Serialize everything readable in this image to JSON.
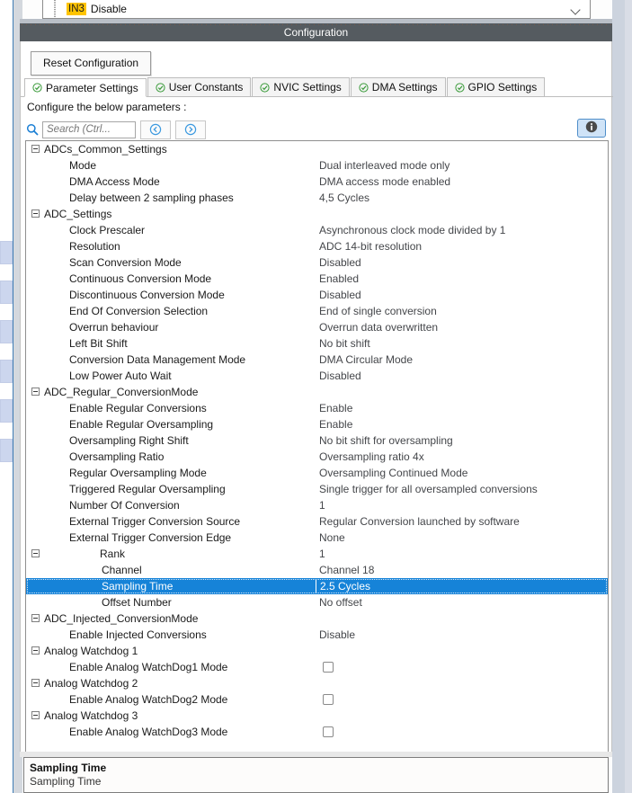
{
  "top_row": {
    "pin_tag": "IN3",
    "value": "Disable",
    "caret_icon": "chevron-down-icon"
  },
  "config_bar": {
    "title": "Configuration"
  },
  "toolbar": {
    "reset_label": "Reset Configuration"
  },
  "tabs": [
    {
      "label": "Parameter Settings",
      "icon": "check-circle-icon",
      "active": true
    },
    {
      "label": "User Constants",
      "icon": "check-circle-icon",
      "active": false
    },
    {
      "label": "NVIC Settings",
      "icon": "check-circle-icon",
      "active": false
    },
    {
      "label": "DMA Settings",
      "icon": "check-circle-icon",
      "active": false
    },
    {
      "label": "GPIO Settings",
      "icon": "check-circle-icon",
      "active": false
    }
  ],
  "configure_label": "Configure the below parameters :",
  "search": {
    "icon": "search-icon",
    "placeholder": "Search (Ctrl...",
    "value": "",
    "prev_icon": "chevron-left-circle-icon",
    "next_icon": "chevron-right-circle-icon"
  },
  "info_button": {
    "icon": "info-icon",
    "label": ""
  },
  "colors": {
    "selection": "#1683d8",
    "title_bar": "#555b60",
    "highlight_tag": "#ffc400",
    "check_green": "#3a9b3a",
    "accent_blue": "#4f8ec9"
  },
  "tree": [
    {
      "level": 0,
      "expander": true,
      "label": "ADCs_Common_Settings",
      "value": ""
    },
    {
      "level": 1,
      "expander": false,
      "label": "Mode",
      "value": "Dual interleaved mode only"
    },
    {
      "level": 1,
      "expander": false,
      "label": "DMA Access Mode",
      "value": "DMA access mode enabled"
    },
    {
      "level": 1,
      "expander": false,
      "label": "Delay between 2 sampling phases",
      "value": "4,5 Cycles"
    },
    {
      "level": 0,
      "expander": true,
      "label": "ADC_Settings",
      "value": ""
    },
    {
      "level": 1,
      "expander": false,
      "label": "Clock Prescaler",
      "value": "Asynchronous clock mode divided by 1"
    },
    {
      "level": 1,
      "expander": false,
      "label": "Resolution",
      "value": "ADC 14-bit resolution"
    },
    {
      "level": 1,
      "expander": false,
      "label": "Scan Conversion Mode",
      "value": "Disabled"
    },
    {
      "level": 1,
      "expander": false,
      "label": "Continuous Conversion Mode",
      "value": "Enabled"
    },
    {
      "level": 1,
      "expander": false,
      "label": "Discontinuous Conversion Mode",
      "value": "Disabled"
    },
    {
      "level": 1,
      "expander": false,
      "label": "End Of Conversion Selection",
      "value": "End of single conversion"
    },
    {
      "level": 1,
      "expander": false,
      "label": "Overrun behaviour",
      "value": "Overrun data overwritten"
    },
    {
      "level": 1,
      "expander": false,
      "label": "Left Bit Shift",
      "value": "No bit shift"
    },
    {
      "level": 1,
      "expander": false,
      "label": "Conversion Data Management Mode",
      "value": "DMA Circular Mode"
    },
    {
      "level": 1,
      "expander": false,
      "label": "Low Power Auto Wait",
      "value": "Disabled"
    },
    {
      "level": 0,
      "expander": true,
      "label": "ADC_Regular_ConversionMode",
      "value": ""
    },
    {
      "level": 1,
      "expander": false,
      "label": "Enable Regular Conversions",
      "value": "Enable"
    },
    {
      "level": 1,
      "expander": false,
      "label": "Enable Regular Oversampling",
      "value": "Enable"
    },
    {
      "level": 1,
      "expander": false,
      "label": "Oversampling Right Shift",
      "value": "No bit shift for oversampling"
    },
    {
      "level": 1,
      "expander": false,
      "label": "Oversampling Ratio",
      "value": "Oversampling ratio 4x"
    },
    {
      "level": 1,
      "expander": false,
      "label": "Regular Oversampling Mode",
      "value": "Oversampling Continued Mode"
    },
    {
      "level": 1,
      "expander": false,
      "label": "Triggered Regular Oversampling",
      "value": "Single trigger for all oversampled conversions"
    },
    {
      "level": 1,
      "expander": false,
      "label": "Number Of Conversion",
      "value": "1"
    },
    {
      "level": 1,
      "expander": false,
      "label": "External Trigger Conversion Source",
      "value": "Regular Conversion launched by software"
    },
    {
      "level": 1,
      "expander": false,
      "label": "External Trigger Conversion Edge",
      "value": "None"
    },
    {
      "level": "1b",
      "expander": true,
      "label": "Rank",
      "value": "1"
    },
    {
      "level": 2,
      "expander": false,
      "label": "Channel",
      "value": "Channel 18"
    },
    {
      "level": 2,
      "expander": false,
      "label": "Sampling Time",
      "value": "2.5 Cycles",
      "selected": true,
      "editing": true
    },
    {
      "level": 2,
      "expander": false,
      "label": "Offset Number",
      "value": "No offset"
    },
    {
      "level": 0,
      "expander": true,
      "label": "ADC_Injected_ConversionMode",
      "value": ""
    },
    {
      "level": 1,
      "expander": false,
      "label": "Enable Injected Conversions",
      "value": "Disable"
    },
    {
      "level": 0,
      "expander": true,
      "label": "Analog Watchdog 1",
      "value": ""
    },
    {
      "level": 1,
      "expander": false,
      "label": "Enable Analog WatchDog1 Mode",
      "value": "",
      "checkbox": true,
      "checked": false
    },
    {
      "level": 0,
      "expander": true,
      "label": "Analog Watchdog 2",
      "value": ""
    },
    {
      "level": 1,
      "expander": false,
      "label": "Enable Analog WatchDog2 Mode",
      "value": "",
      "checkbox": true,
      "checked": false
    },
    {
      "level": 0,
      "expander": true,
      "label": "Analog Watchdog 3",
      "value": ""
    },
    {
      "level": 1,
      "expander": false,
      "label": "Enable Analog WatchDog3 Mode",
      "value": "",
      "checkbox": true,
      "checked": false
    }
  ],
  "description": {
    "title": "Sampling Time",
    "body": "Sampling Time"
  }
}
